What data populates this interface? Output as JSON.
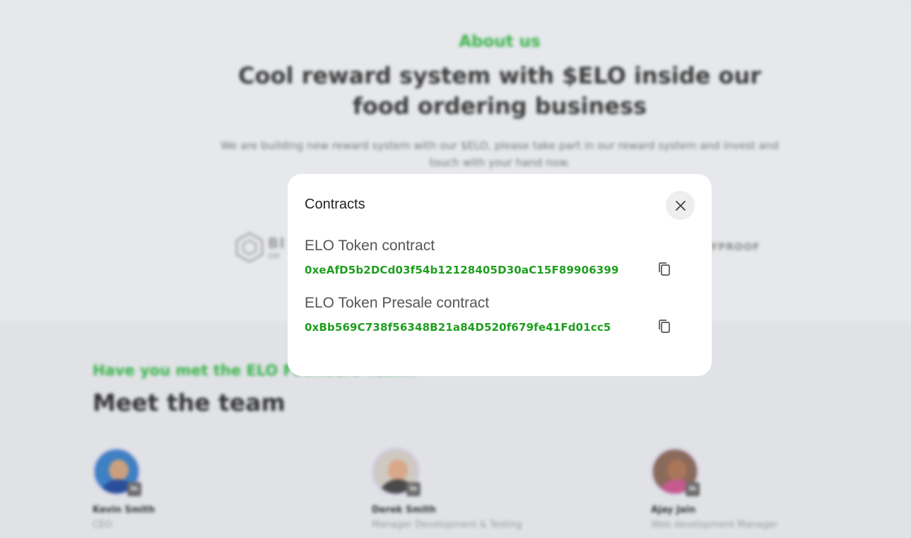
{
  "background": {
    "about": {
      "eyebrow": "About us",
      "title": "Cool reward system with $ELO inside our food ordering business",
      "description": "We are building new reward system with our $ELO, please take part in our reward system and invest and touch with your hand now."
    },
    "partners": {
      "left_name": "BI",
      "left_sub": "SM",
      "right_name": "YPROOF"
    },
    "team": {
      "eyebrow": "Have you met the ELO Founders Team?",
      "title": "Meet the team",
      "members": [
        {
          "name": "Kevin Smith",
          "role": "CEO",
          "social_icon": "linkedin-icon"
        },
        {
          "name": "Derek Smith",
          "role": "Manager Development & Testing",
          "social_icon": "linkedin-icon"
        },
        {
          "name": "Ajay Jain",
          "role": "Web development Manager",
          "social_icon": "linkedin-icon"
        }
      ]
    }
  },
  "modal": {
    "title": "Contracts",
    "close_icon": "close-icon",
    "contracts": [
      {
        "label": "ELO Token contract",
        "address": "0xeAfD5b2DCd03f54b12128405D30aC15F89906399",
        "copy_icon": "copy-icon"
      },
      {
        "label": "ELO Token Presale contract",
        "address": "0xBb569C738f56348B21a84D520f679fe41Fd01cc5",
        "copy_icon": "copy-icon"
      }
    ]
  },
  "colors": {
    "accent_green": "#1e9e1e",
    "eyebrow_green": "#38b24a",
    "overlay_bg": "#e3e5e8",
    "modal_bg": "#ffffff"
  }
}
